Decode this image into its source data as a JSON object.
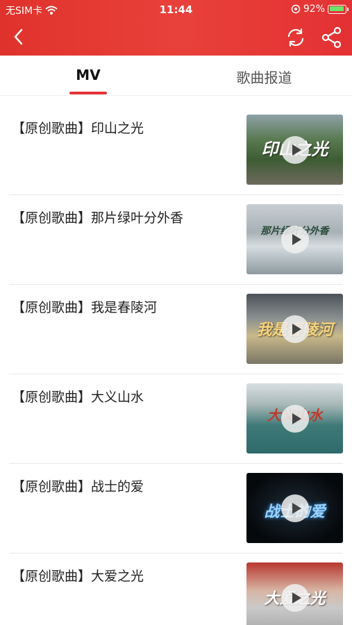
{
  "status_bar": {
    "carrier": "无SIM卡",
    "time": "11:44",
    "battery": "92%"
  },
  "tabs": [
    {
      "label": "MV",
      "active": true
    },
    {
      "label": "歌曲报道",
      "active": false
    }
  ],
  "items": [
    {
      "title": "【原创歌曲】印山之光",
      "thumb_text": "印山之光"
    },
    {
      "title": "【原创歌曲】那片绿叶分外香",
      "thumb_text": "那片绿叶分外香"
    },
    {
      "title": "【原创歌曲】我是春陵河",
      "thumb_text": "我是春陵河"
    },
    {
      "title": "【原创歌曲】大义山水",
      "thumb_text": "大义山水"
    },
    {
      "title": "【原创歌曲】战士的爱",
      "thumb_text": "战士的爱"
    },
    {
      "title": "【原创歌曲】大爱之光",
      "thumb_text": "大爱之光"
    }
  ],
  "colors": {
    "header": "#e43134",
    "indicator": "#e43134"
  },
  "icons": [
    "back-icon",
    "refresh-icon",
    "share-icon",
    "play-icon",
    "wifi-icon",
    "battery-icon"
  ]
}
